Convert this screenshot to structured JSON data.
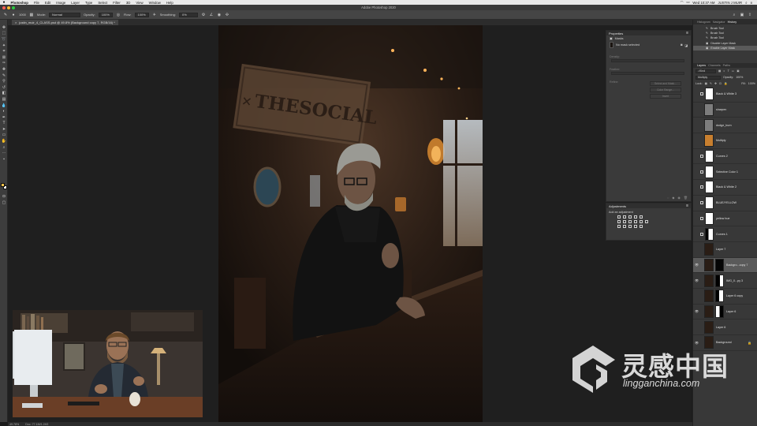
{
  "menubar": {
    "app": "Photoshop",
    "items": [
      "File",
      "Edit",
      "Image",
      "Layer",
      "Type",
      "Select",
      "Filter",
      "3D",
      "View",
      "Window",
      "Help"
    ],
    "clock": "Wed 10:37 AM",
    "user": "JUSTIN J MUIR"
  },
  "window": {
    "title": "Adobe Photoshop 2020"
  },
  "options_bar": {
    "brush_size": "1000",
    "mode_label": "Mode:",
    "mode_value": "Normal",
    "opacity_label": "Opacity:",
    "opacity_value": "100%",
    "flow_label": "Flow:",
    "flow_value": "100%",
    "smoothing_label": "Smoothing:",
    "smoothing_value": "0%"
  },
  "document": {
    "tab": "justin_muir_4_CLASS.psd @ 49.8% (Background copy 7, RGB/16) *"
  },
  "status": {
    "zoom": "49.78%",
    "doc_info": "Doc: 77.1M/1.24G"
  },
  "properties": {
    "title": "Properties",
    "mode": "Masks",
    "no_mask": "No mask selected",
    "density_label": "Density:",
    "feather_label": "Feather:",
    "refine_label": "Refine:",
    "select_mask_btn": "Select and Mask...",
    "color_range_btn": "Color Range...",
    "invert_btn": "Invert"
  },
  "adjustments": {
    "title": "Adjustments",
    "hint": "Add an adjustment"
  },
  "history": {
    "tabs": [
      "Histogram",
      "Navigator",
      "History"
    ],
    "active_tab": "History",
    "items": [
      "Brush Tool",
      "Brush Tool",
      "Brush Tool",
      "Disable Layer Mask",
      "Enable Layer Mask"
    ]
  },
  "layers_panel": {
    "tabs": [
      "Layers",
      "Channels",
      "Paths"
    ],
    "active_tab": "Layers",
    "filter": "Kind",
    "blend_mode": "Multiply",
    "opacity_label": "Opacity:",
    "opacity_value": "100%",
    "lock_label": "Lock:",
    "fill_label": "Fill:",
    "fill_value": "100%",
    "layers": [
      {
        "name": "Black & White 3"
      },
      {
        "name": "sharpen"
      },
      {
        "name": "dodge_burn"
      },
      {
        "name": "Multiply"
      },
      {
        "name": "Curves 2"
      },
      {
        "name": "Selective Color 1"
      },
      {
        "name": "Black & White 2"
      },
      {
        "name": "BLUE/YELLOW"
      },
      {
        "name": "yellow hue"
      },
      {
        "name": "Curves 1"
      },
      {
        "name": "Layer 7"
      },
      {
        "name": "Backgro...copy 7"
      },
      {
        "name": "IMG_0...py 3"
      },
      {
        "name": "Layer 6 copy"
      },
      {
        "name": "Layer 6"
      },
      {
        "name": "Layer 6"
      },
      {
        "name": "Background"
      }
    ]
  },
  "photo": {
    "sign_text": "THESOCIAL"
  },
  "watermark": {
    "chinese": "灵感中国",
    "url": "lingganchina.com"
  },
  "colors": {
    "foreground": "#f3c047",
    "background": "#ffffff",
    "multiply_swatch": "#c87f2f"
  }
}
